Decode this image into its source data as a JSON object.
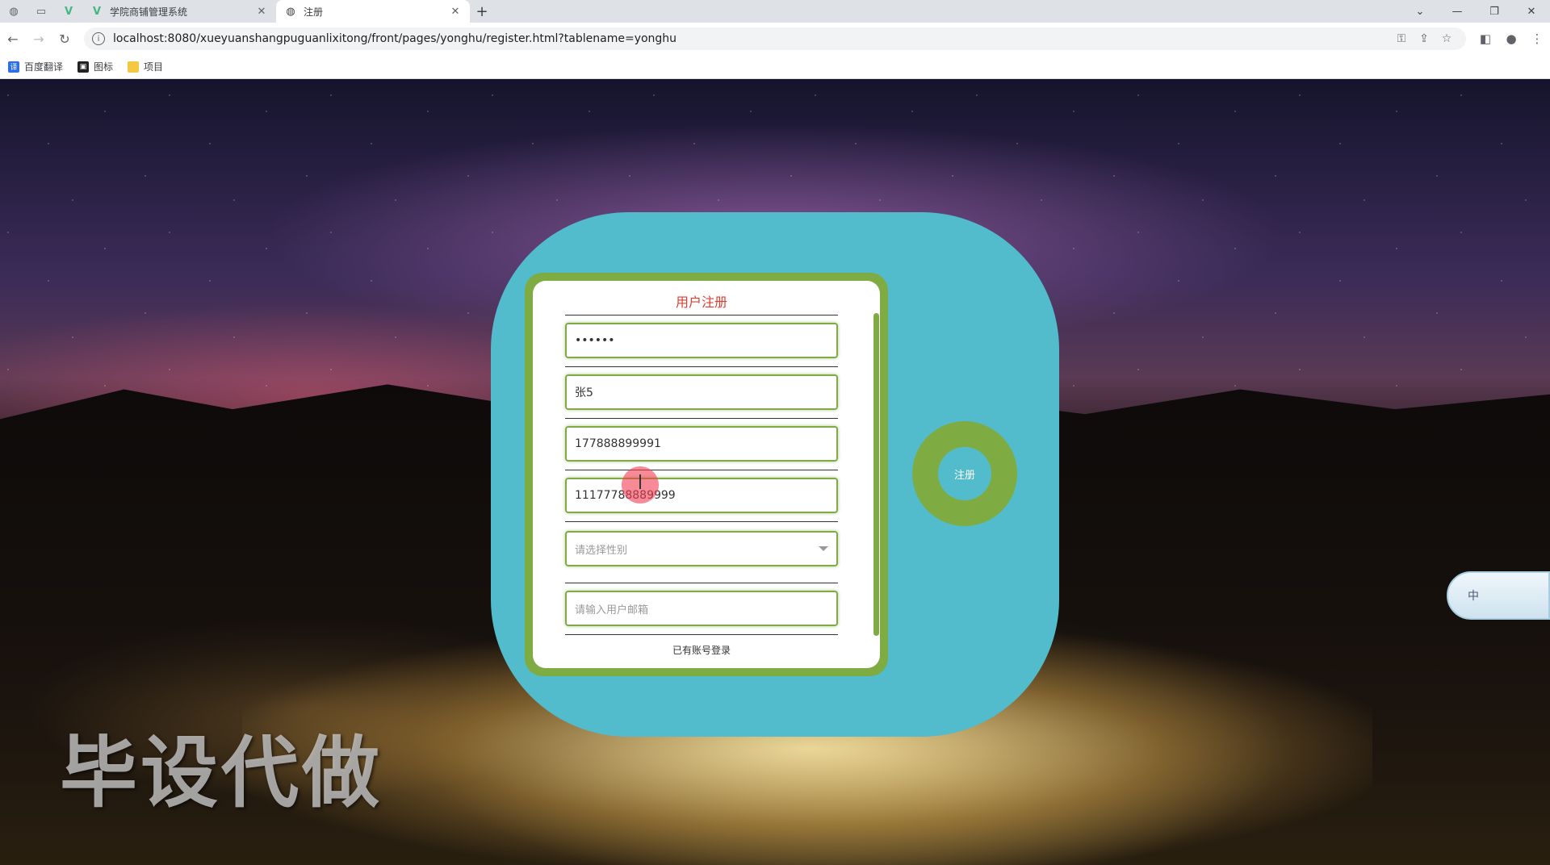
{
  "browser": {
    "tabs": [
      {
        "title": "学院商铺管理系统",
        "close": "✕"
      },
      {
        "title": "注册",
        "close": "✕"
      }
    ],
    "new_tab": "+",
    "window_controls": [
      "⌄",
      "—",
      "❐",
      "✕"
    ],
    "url": "localhost:8080/xueyuanshangpuguanlixitong/front/pages/yonghu/register.html?tablename=yonghu",
    "bookmarks": [
      "百度翻译",
      "图标",
      "项目"
    ]
  },
  "form": {
    "title": "用户注册",
    "fields": [
      {
        "value": "••••••"
      },
      {
        "value": "张5"
      },
      {
        "value": "177888899991"
      },
      {
        "value": "11177788889999"
      },
      {
        "placeholder": "请选择性别"
      },
      {
        "placeholder": "请输入用户邮箱"
      }
    ],
    "login_link": "已有账号登录",
    "register_button": "注册"
  },
  "watermark": "毕设代做",
  "ime": {
    "label": "中"
  },
  "colors": {
    "panel": "#52bccc",
    "frame": "#7fac42",
    "title": "#e03c31"
  }
}
